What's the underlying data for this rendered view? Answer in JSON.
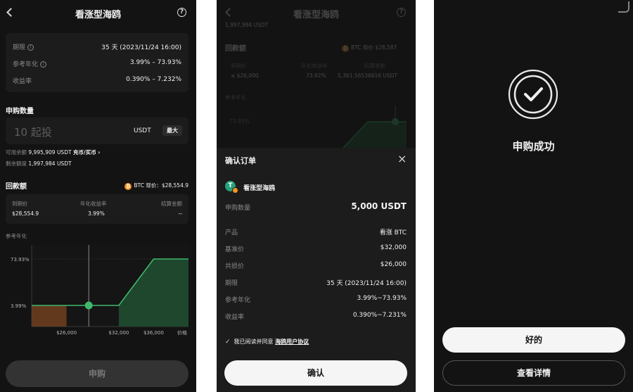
{
  "screen1": {
    "title": "看涨型海鸥",
    "help": "?",
    "term_label": "期限",
    "term_value": "35 天 (2023/11/24 16:00)",
    "apr_label": "参考年化",
    "apr_value": "3.99% – 73.93%",
    "yield_label": "收益率",
    "yield_value": "0.390% – 7.232%",
    "amount_heading": "申购数量",
    "amount_placeholder": "10 起投",
    "currency": "USDT",
    "max_label": "最大",
    "available_label": "可用余额",
    "available_value": "9,995,909 USDT",
    "deposit_link": "充币/买币 ›",
    "remaining_label": "剩余额度",
    "remaining_value": "1,997,984 USDT",
    "payout_heading": "回款额",
    "btc_price_label": "BTC 现价：",
    "btc_price_value": "$28,554.9",
    "col1_label": "到期价",
    "col1_value": "$28,554.9",
    "col2_label": "年化收益率",
    "col2_value": "3.99%",
    "col3_label": "结算金额",
    "col3_value": "--",
    "chart_title": "参考年化",
    "submit_label": "申购"
  },
  "chart_data": {
    "type": "line",
    "title": "参考年化",
    "x_ticks": [
      "$26,000",
      "$32,000",
      "$36,000",
      "价格"
    ],
    "y_ticks": [
      "73.93%",
      "3.99%"
    ],
    "series": [
      {
        "values": [
          {
            "x": 22000,
            "y": 3.99
          },
          {
            "x": 32000,
            "y": 3.99
          },
          {
            "x": 36000,
            "y": 73.93
          },
          {
            "x": 40000,
            "y": 73.93
          }
        ]
      }
    ],
    "current_point": {
      "x": 28554.9,
      "y": 3.99
    },
    "colors": {
      "line": "#3fb86b",
      "fill": "#1f4a2f",
      "low_zone": "#6b3d1e"
    }
  },
  "screen2": {
    "bg_title": "看涨型海鸥",
    "bg_remaining": "1,997,984 USDT",
    "bg_payout": "回款额",
    "bg_btc": "BTC 现价",
    "bg_btc_val": "$28,587",
    "bg_col1": "到期价",
    "bg_col2": "年化收益率",
    "bg_col3": "结算金额",
    "bg_v1": "≤ $26,000",
    "bg_v2": "73.92%",
    "bg_v3": "5,361.56536616 USDT",
    "bg_chart_label": "参考年化",
    "bg_chart_tick": "73.93%",
    "sheet_title": "确认订单",
    "product_name": "看涨型海鸥",
    "amount_label": "申购数量",
    "amount_value": "5,000 USDT",
    "rows": [
      {
        "label": "产品",
        "value": "看涨 BTC"
      },
      {
        "label": "基准价",
        "value": "$32,000"
      },
      {
        "label": "共损价",
        "value": "$26,000"
      },
      {
        "label": "期限",
        "value": "35 天 (2023/11/24 16:00)"
      },
      {
        "label": "参考年化",
        "value": "3.99%~73.93%"
      },
      {
        "label": "收益率",
        "value": "0.390%~7.231%"
      }
    ],
    "agree_text": "我已阅读并同意",
    "agreement_link": "海鸥用户协议",
    "confirm_label": "确认"
  },
  "screen3": {
    "success_text": "申购成功",
    "ok_label": "好的",
    "details_label": "查看详情"
  }
}
